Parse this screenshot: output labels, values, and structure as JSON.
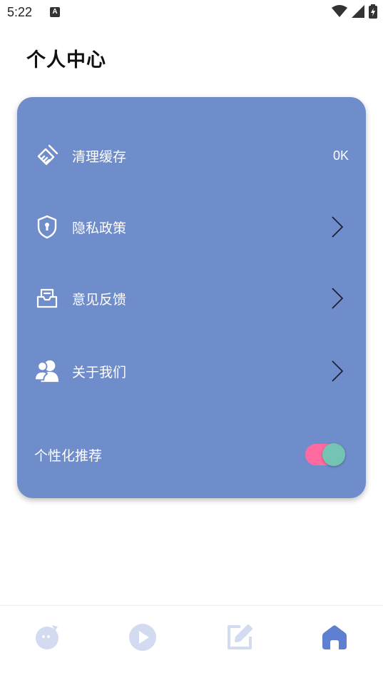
{
  "status": {
    "time": "5:22",
    "indicator": "A"
  },
  "header": {
    "title": "个人中心"
  },
  "menu": {
    "clear_cache": {
      "label": "清理缓存",
      "value": "0K",
      "icon": "broom-icon"
    },
    "privacy": {
      "label": "隐私政策",
      "icon": "shield-lock-icon"
    },
    "feedback": {
      "label": "意见反馈",
      "icon": "feedback-inbox-icon"
    },
    "about": {
      "label": "关于我们",
      "icon": "users-icon"
    },
    "recommend": {
      "label": "个性化推荐",
      "enabled": true
    }
  },
  "bottom_nav": {
    "items": [
      {
        "icon": "chat-bubble-icon",
        "active": false
      },
      {
        "icon": "play-icon",
        "active": false
      },
      {
        "icon": "edit-icon",
        "active": false
      },
      {
        "icon": "home-icon",
        "active": true
      }
    ]
  },
  "colors": {
    "card": "#6f8ccb",
    "toggle_track": "#ff6b9f",
    "toggle_knob": "#74c4b4",
    "nav_inactive": "#d3dbf0",
    "nav_active": "#5f7fd0"
  }
}
